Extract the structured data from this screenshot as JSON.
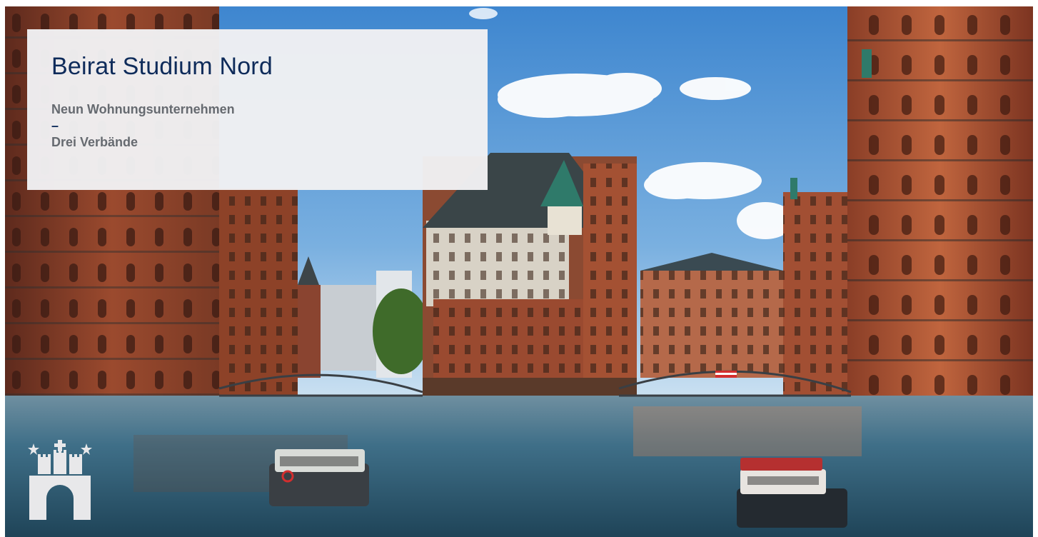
{
  "card": {
    "title": "Beirat Studium Nord",
    "subtitle_1": "Neun Wohnungsunternehmen",
    "separator": "–",
    "subtitle_2": "Drei Verbände"
  },
  "background": {
    "scene": "speicherstadt-canal-photo"
  },
  "logo": {
    "icon": "hamburg-coat-of-arms-icon"
  },
  "colors": {
    "title": "#0e2b5a",
    "subtitle": "#666a70",
    "card_background": "#f1f1f3",
    "brick": "#a5492e",
    "sky": "#4f8fd0",
    "water": "#3b6f8c"
  }
}
